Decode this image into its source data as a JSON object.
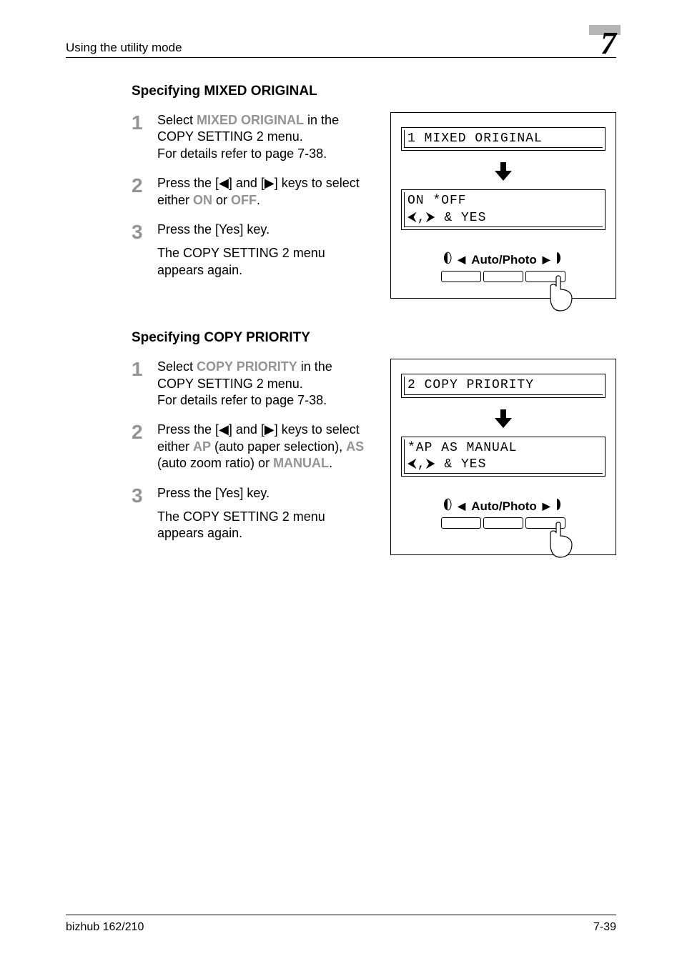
{
  "running": {
    "left": "Using the utility mode",
    "chapter": "7"
  },
  "section1": {
    "heading": "Specifying MIXED ORIGINAL",
    "step1_prefix": "Select ",
    "step1_highlight": "MIXED ORIGINAL",
    "step1_after": " in the COPY SETTING 2 menu.",
    "step1_line2": "For details refer to page 7-38.",
    "step2_prefix": "Press the [◀] and [▶] keys to select either ",
    "step2_on": "ON",
    "step2_or": " or ",
    "step2_off": "OFF",
    "step2_end": ".",
    "step3_line1": "Press the [Yes] key.",
    "step3_line2": "The COPY SETTING 2 menu appears again.",
    "lcd1": "1 MIXED ORIGINAL",
    "lcd2_line1": "ON        *OFF",
    "lcd2_line2": " ⮜,⮞ & YES",
    "autophoto": "Auto/Photo"
  },
  "section2": {
    "heading": "Specifying COPY PRIORITY",
    "step1_prefix": "Select ",
    "step1_highlight": "COPY PRIORITY",
    "step1_after": " in the COPY SETTING 2 menu.",
    "step1_line2": "For details refer to page 7-38.",
    "step2_prefix": "Press the [◀] and [▶] keys to select either ",
    "step2_ap": "AP",
    "step2_ap_after": " (auto paper selection), ",
    "step2_as": "AS",
    "step2_as_after": " (auto zoom ratio) or ",
    "step2_manual": "MANUAL",
    "step2_end": ".",
    "step3_line1": "Press the [Yes] key.",
    "step3_line2": "The COPY SETTING 2 menu appears again.",
    "lcd1": "2 COPY PRIORITY",
    "lcd2_line1": "*AP    AS    MANUAL",
    "lcd2_line2": " ⮜,⮞ & YES",
    "autophoto": "Auto/Photo"
  },
  "footer": {
    "left": "bizhub 162/210",
    "right": "7-39"
  },
  "step_numbers": {
    "n1": "1",
    "n2": "2",
    "n3": "3"
  }
}
